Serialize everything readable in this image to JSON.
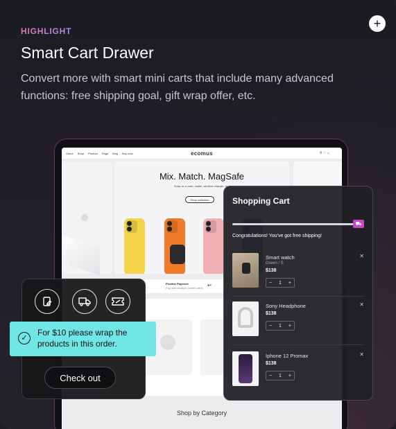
{
  "header": {
    "eyebrow": "HIGHLIGHT",
    "title": "Smart Cart Drawer",
    "description": "Convert more with smart mini carts that include many advanced functions: free shipping goal, gift wrap offer, etc.",
    "plus_icon": "plus-icon"
  },
  "store": {
    "logo": "ecomus",
    "nav_items": [
      "Home",
      "Shop",
      "Product",
      "Page",
      "Blog",
      "Buy now"
    ],
    "hero_title": "Mix. Match. MagSafe",
    "hero_subtitle": "Snap on a case, wallet, wireless charger, or...",
    "hero_button": "Shop collection",
    "feature_title": "Flexible Payment",
    "feature_sub": "Pay with Multiple Credit Cards",
    "footer_label": "Shop by Category"
  },
  "panel": {
    "icons": [
      "edit-note-icon",
      "shipping-truck-icon",
      "coupon-icon"
    ],
    "wrap_offer": "For $10 please wrap the products in this order.",
    "checkout_label": "Check out"
  },
  "cart": {
    "title": "Shopping Cart",
    "congrats": "Congratulations! You've got free shipping!",
    "items": [
      {
        "name": "Smart watch",
        "variant": "Green / S",
        "price": "$138",
        "qty": "1"
      },
      {
        "name": "Sony Headphone",
        "variant": "",
        "price": "$138",
        "qty": "1"
      },
      {
        "name": "Iphone 12 Promax",
        "variant": "",
        "price": "$138",
        "qty": "1"
      }
    ]
  },
  "colors": {
    "accent_cyan": "#6fe5e5",
    "accent_pink": "#c24cc2"
  }
}
